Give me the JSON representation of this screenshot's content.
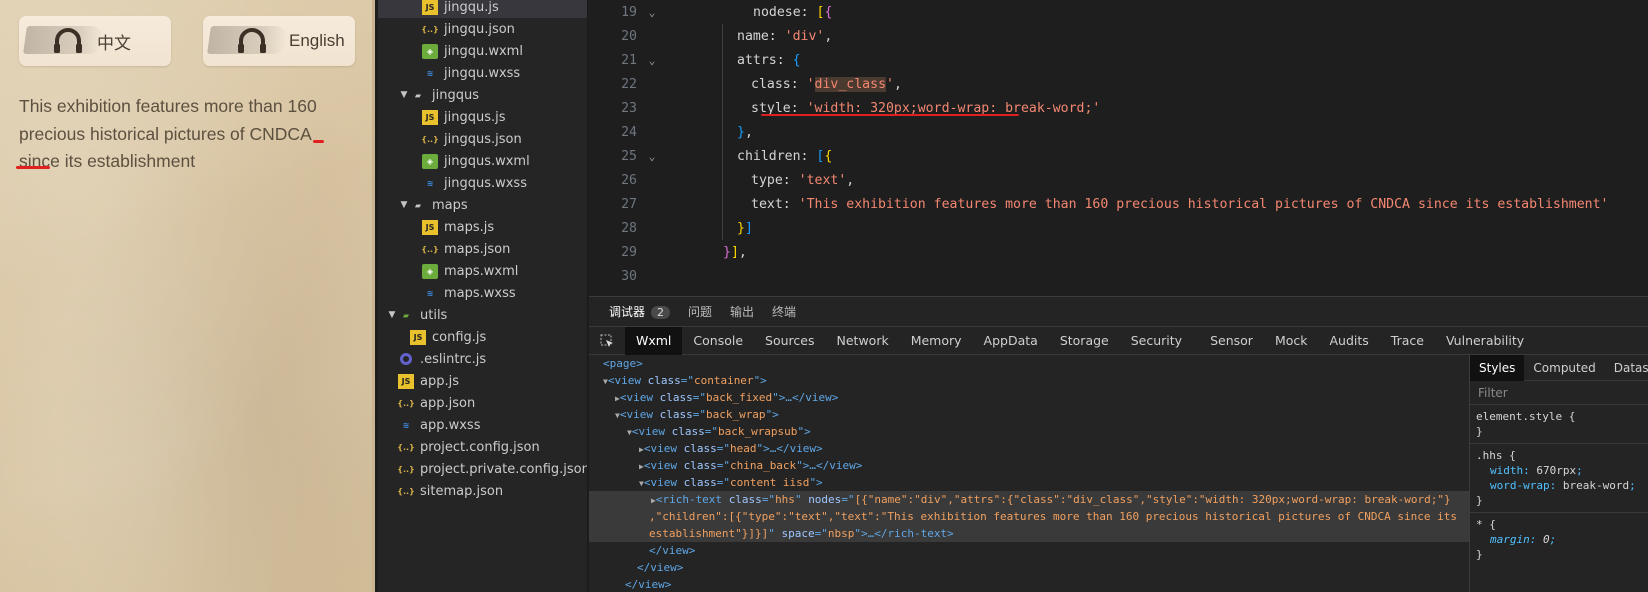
{
  "simulator": {
    "btn_zh": "中文",
    "btn_en": "English",
    "content_text": "This exhibition features more than 160 precious historical pictures of CNDCA since its establishment"
  },
  "tree": [
    {
      "label": "jingqu.js",
      "type": "js",
      "indent": 2,
      "active": true
    },
    {
      "label": "jingqu.json",
      "type": "json",
      "indent": 2
    },
    {
      "label": "jingqu.wxml",
      "type": "wxml",
      "indent": 2
    },
    {
      "label": "jingqu.wxss",
      "type": "wxss",
      "indent": 2
    },
    {
      "label": "jingqus",
      "type": "folder",
      "indent": 1,
      "open": true
    },
    {
      "label": "jingqus.js",
      "type": "js",
      "indent": 2
    },
    {
      "label": "jingqus.json",
      "type": "json",
      "indent": 2
    },
    {
      "label": "jingqus.wxml",
      "type": "wxml",
      "indent": 2
    },
    {
      "label": "jingqus.wxss",
      "type": "wxss",
      "indent": 2
    },
    {
      "label": "maps",
      "type": "folder",
      "indent": 1,
      "open": true
    },
    {
      "label": "maps.js",
      "type": "js",
      "indent": 2
    },
    {
      "label": "maps.json",
      "type": "json",
      "indent": 2
    },
    {
      "label": "maps.wxml",
      "type": "wxml",
      "indent": 2
    },
    {
      "label": "maps.wxss",
      "type": "wxss",
      "indent": 2
    },
    {
      "label": "utils",
      "type": "folder-green",
      "indent": 0,
      "open": true
    },
    {
      "label": "config.js",
      "type": "js",
      "indent": 1
    },
    {
      "label": ".eslintrc.js",
      "type": "eslint",
      "indent": 0
    },
    {
      "label": "app.js",
      "type": "js",
      "indent": 0
    },
    {
      "label": "app.json",
      "type": "json",
      "indent": 0
    },
    {
      "label": "app.wxss",
      "type": "wxss",
      "indent": 0
    },
    {
      "label": "project.config.json",
      "type": "json",
      "indent": 0
    },
    {
      "label": "project.private.config.json",
      "type": "json",
      "indent": 0
    },
    {
      "label": "sitemap.json",
      "type": "json",
      "indent": 0
    }
  ],
  "editor": {
    "line_numbers": [
      "19",
      "20",
      "21",
      "22",
      "23",
      "24",
      "25",
      "26",
      "27",
      "28",
      "29",
      "30"
    ],
    "l19_key": "nodese",
    "l20_key": "name",
    "l20_val": "'div'",
    "l21_key": "attrs",
    "l22_key": "class",
    "l22_val": "div_class",
    "l23_key": "style",
    "l23_val": "'width: 320px;word-wrap: break-word;'",
    "l25_key": "children",
    "l26_key": "type",
    "l26_val": "'text'",
    "l27_key": "text",
    "l27_val": "'This exhibition features more than 160 precious historical pictures of CNDCA since its establishment'"
  },
  "devtools": {
    "top_tabs": [
      "调试器",
      "问题",
      "输出",
      "终端"
    ],
    "badge": "2",
    "main_tabs": [
      "Wxml",
      "Console",
      "Sources",
      "Network",
      "Memory",
      "AppData",
      "Storage",
      "Security",
      "Sensor",
      "Mock",
      "Audits",
      "Trace",
      "Vulnerability"
    ],
    "style_tabs": [
      "Styles",
      "Computed",
      "Dataset"
    ],
    "filter_placeholder": "Filter",
    "dom": {
      "page": "<page>",
      "container": "container",
      "back_fixed": "back_fixed",
      "back_wrap": "back_wrap",
      "back_wrapsub": "back_wrapsub",
      "head": "head",
      "china_back": "china_back",
      "content": "content iisd",
      "rich_class": "hhs",
      "rich_nodes_1": "[{\"name\":\"div\",\"attrs\":{\"class\":\"div_class\",\"style\":\"width: 320px;word-wrap: break-word;\"}",
      "rich_nodes_2": ",\"children\":[{\"type\":\"text\",\"text\":\"This exhibition features more than 160 precious historical pictures of CNDCA since its",
      "rich_nodes_3": "establishment\"}]}]",
      "space": "nbsp"
    },
    "styles": {
      "element_style": "element.style {",
      "hhs_selector": ".hhs {",
      "hhs_width": "670rpx",
      "hhs_wordwrap": "break-word",
      "star_selector": "* {",
      "star_margin": "0"
    }
  },
  "colors": {
    "annotation_red": "#e02020",
    "paper": "#dac8a8"
  }
}
